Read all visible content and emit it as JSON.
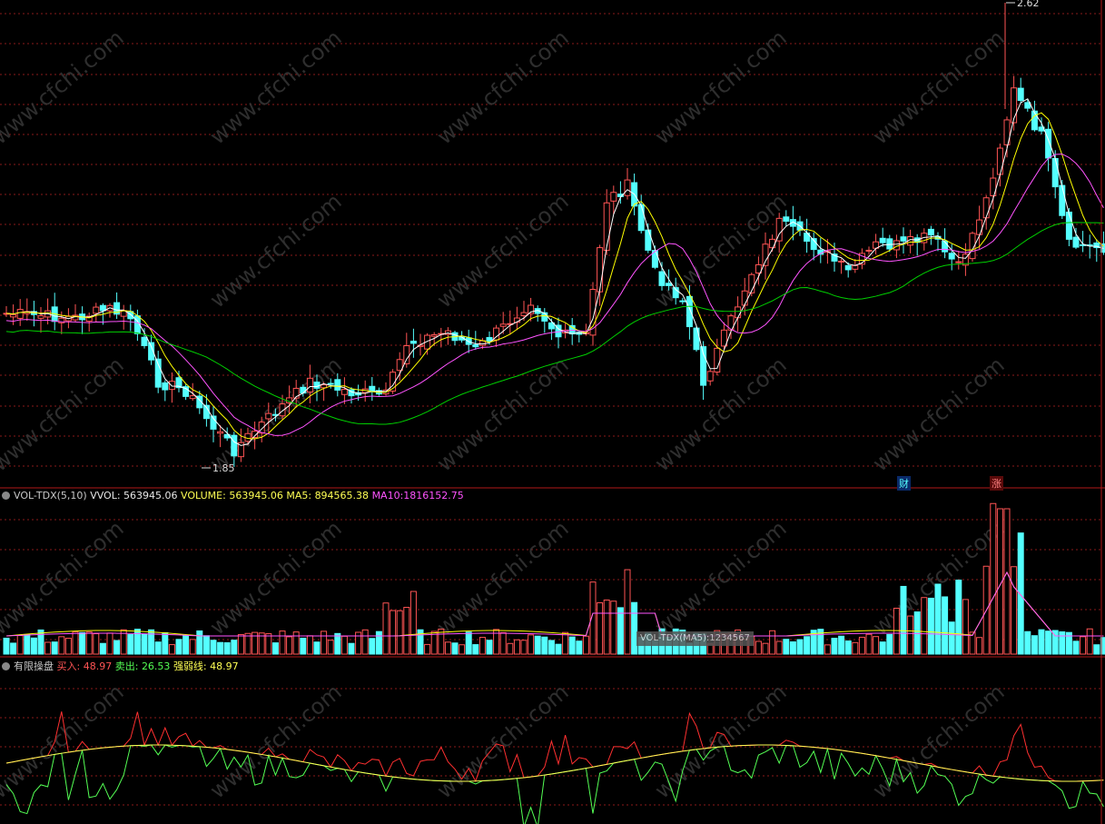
{
  "colors": {
    "background": "#000000",
    "grid": "#8a1a1a",
    "separator": "#b01818",
    "candle_up": "#ff5454",
    "candle_down": "#54ffff",
    "ma_white": "#ffffff",
    "ma_yellow": "#ffff00",
    "ma_magenta": "#ff54ff",
    "ma_green": "#00d000"
  },
  "watermark": "www.cfchi.com",
  "price_panel": {
    "high_label": "2.62",
    "low_label": "1.85",
    "tags": {
      "cai": "财",
      "zhang": "涨"
    }
  },
  "volume_panel": {
    "name": "VOL-TDX(5,10)",
    "vvol_label": "VVOL:",
    "vvol_value": "563945.06",
    "volume_label": "VOLUME:",
    "volume_value": "563945.06",
    "ma5_label": "MA5:",
    "ma5_value": "894565.38",
    "ma10_label": "MA10:",
    "ma10_value": "1816152.75",
    "tooltip": "VOL-TDX(MA5):1234567"
  },
  "indicator_panel": {
    "name": "有限操盘",
    "buy_label": "买入:",
    "buy_value": "48.97",
    "sell_label": "卖出:",
    "sell_value": "26.53",
    "strength_label": "强弱线:",
    "strength_value": "48.97"
  },
  "chart_data": [
    {
      "type": "candlestick",
      "title": "",
      "annotations": [
        "2.62",
        "1.85",
        "财",
        "涨"
      ],
      "ylim": [
        1.8,
        2.65
      ],
      "x_count": 160,
      "series": [
        {
          "name": "",
          "ohlc_note": "candlestick series with moving averages (white, yellow, magenta, green)"
        }
      ]
    },
    {
      "type": "bar",
      "title": "VOL-TDX(5,10)",
      "series": [
        {
          "name": "VOLUME",
          "last": 563945.06
        },
        {
          "name": "MA5",
          "last": 894565.38
        },
        {
          "name": "MA10",
          "last": 1816152.75
        }
      ]
    },
    {
      "type": "line",
      "title": "有限操盘",
      "series": [
        {
          "name": "买入",
          "last": 48.97
        },
        {
          "name": "卖出",
          "last": 26.53
        },
        {
          "name": "强弱线",
          "last": 48.97
        }
      ]
    }
  ]
}
